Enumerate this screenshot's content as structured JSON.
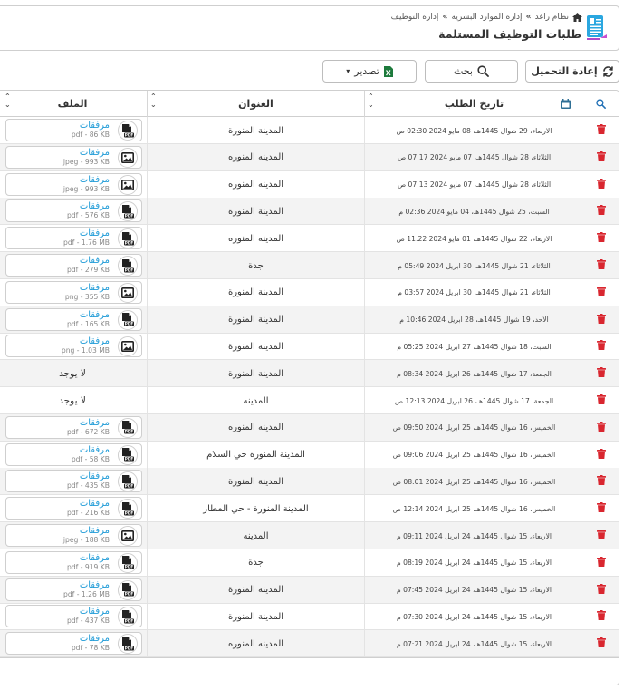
{
  "header": {
    "breadcrumb": [
      "نظام راغد",
      "إدارة الموارد البشرية",
      "إدارة التوظيف"
    ],
    "title": "طلبات التوظيف المستلمة"
  },
  "toolbar": {
    "reload_label": "إعادة التحميل",
    "search_label": "بحث",
    "export_label": "تصدير"
  },
  "table": {
    "columns": [
      "تاريخ الطلب",
      "العنوان",
      "الملف"
    ],
    "file_label": "مرفقات",
    "no_file_label": "لا يوجد",
    "rows": [
      {
        "date": "الاربعاء، 29 شوال 1445هـ، 08 مايو 2024 02:30 ص",
        "title": "المدينة المنورة",
        "file": "pdf - 86 KB",
        "file_type": "pdf"
      },
      {
        "date": "الثلاثاء، 28 شوال 1445هـ، 07 مايو 2024 07:17 ص",
        "title": "المدينه المنوره",
        "file": "jpeg - 993 KB",
        "file_type": "image"
      },
      {
        "date": "الثلاثاء، 28 شوال 1445هـ، 07 مايو 2024 07:13 ص",
        "title": "المدينه المنوره",
        "file": "jpeg - 993 KB",
        "file_type": "image"
      },
      {
        "date": "السبت، 25 شوال 1445هـ، 04 مايو 2024 02:36 م",
        "title": "المدينة المنورة",
        "file": "pdf - 576 KB",
        "file_type": "pdf"
      },
      {
        "date": "الاربعاء، 22 شوال 1445هـ، 01 مايو 2024 11:22 ص",
        "title": "المدينه المنوره",
        "file": "pdf - 1.76 MB",
        "file_type": "pdf"
      },
      {
        "date": "الثلاثاء، 21 شوال 1445هـ، 30 ابريل 2024 05:49 م",
        "title": "جدة",
        "file": "pdf - 279 KB",
        "file_type": "pdf"
      },
      {
        "date": "الثلاثاء، 21 شوال 1445هـ، 30 ابريل 2024 03:57 م",
        "title": "المدينة المنورة",
        "file": "png - 355 KB",
        "file_type": "image"
      },
      {
        "date": "الاحد، 19 شوال 1445هـ، 28 ابريل 2024 10:46 م",
        "title": "المدينة المنورة",
        "file": "pdf - 165 KB",
        "file_type": "pdf"
      },
      {
        "date": "السبت، 18 شوال 1445هـ، 27 ابريل 2024 05:25 م",
        "title": "المدينة المنورة",
        "file": "png - 1.03 MB",
        "file_type": "image"
      },
      {
        "date": "الجمعة، 17 شوال 1445هـ، 26 ابريل 2024 08:34 م",
        "title": "المدينة المنورة",
        "file": null,
        "file_type": null
      },
      {
        "date": "الجمعة، 17 شوال 1445هـ، 26 ابريل 2024 12:13 ص",
        "title": "المدينه",
        "file": null,
        "file_type": null
      },
      {
        "date": "الخميس، 16 شوال 1445هـ، 25 ابريل 2024 09:50 ص",
        "title": "المدينه المنوره",
        "file": "pdf - 672 KB",
        "file_type": "pdf"
      },
      {
        "date": "الخميس، 16 شوال 1445هـ، 25 ابريل 2024 09:06 ص",
        "title": "المدينة المنورة حي السلام",
        "file": "pdf - 58 KB",
        "file_type": "pdf"
      },
      {
        "date": "الخميس، 16 شوال 1445هـ، 25 ابريل 2024 08:01 ص",
        "title": "المدينة المنورة",
        "file": "pdf - 435 KB",
        "file_type": "pdf"
      },
      {
        "date": "الخميس، 16 شوال 1445هـ، 25 ابريل 2024 12:14 ص",
        "title": "المدينة المنورة - حي المطار",
        "file": "pdf - 216 KB",
        "file_type": "pdf"
      },
      {
        "date": "الاربعاء، 15 شوال 1445هـ، 24 ابريل 2024 09:11 م",
        "title": "المدينه",
        "file": "jpeg - 188 KB",
        "file_type": "image"
      },
      {
        "date": "الاربعاء، 15 شوال 1445هـ، 24 ابريل 2024 08:19 م",
        "title": "جدة",
        "file": "pdf - 919 KB",
        "file_type": "pdf"
      },
      {
        "date": "الاربعاء، 15 شوال 1445هـ، 24 ابريل 2024 07:45 م",
        "title": "المدينة المنورة",
        "file": "pdf - 1.26 MB",
        "file_type": "pdf"
      },
      {
        "date": "الاربعاء، 15 شوال 1445هـ، 24 ابريل 2024 07:30 م",
        "title": "المدينة المنورة",
        "file": "pdf - 437 KB",
        "file_type": "pdf"
      },
      {
        "date": "الاربعاء، 15 شوال 1445هـ، 24 ابريل 2024 07:21 م",
        "title": "المدينه المنوره",
        "file": "pdf - 78 KB",
        "file_type": "pdf"
      }
    ]
  },
  "colors": {
    "accent": "#1f9bd7",
    "delete": "#d9262f",
    "pdf_icon": "#222222"
  }
}
